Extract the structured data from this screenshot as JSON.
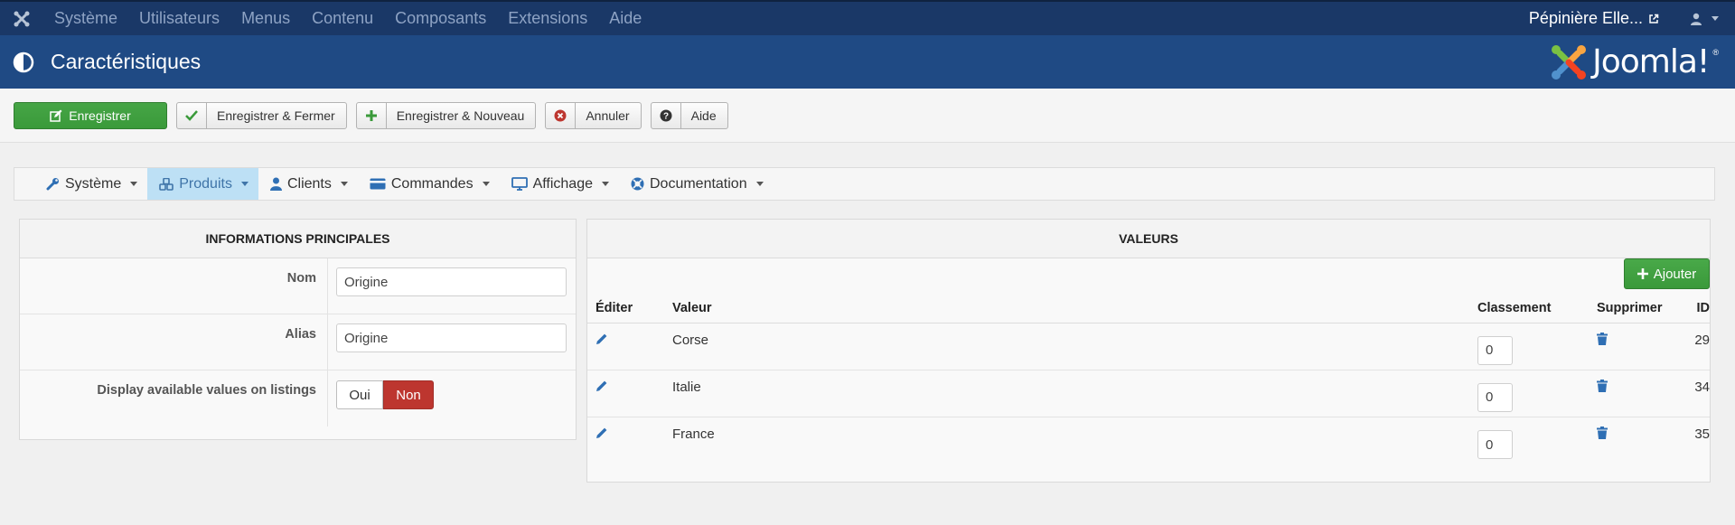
{
  "topbar": {
    "menu": [
      "Système",
      "Utilisateurs",
      "Menus",
      "Contenu",
      "Composants",
      "Extensions",
      "Aide"
    ],
    "site_name": "Pépinière Elle..."
  },
  "header": {
    "title": "Caractéristiques",
    "brand": "Joomla!",
    "brand_reg": "®"
  },
  "toolbar": {
    "save_label": "Enregistrer",
    "save_close_label": "Enregistrer & Fermer",
    "save_new_label": "Enregistrer & Nouveau",
    "cancel_label": "Annuler",
    "help_label": "Aide"
  },
  "compnav": {
    "items": [
      {
        "label": "Système",
        "icon": "wrench-icon",
        "active": false
      },
      {
        "label": "Produits",
        "icon": "cubes-icon",
        "active": true
      },
      {
        "label": "Clients",
        "icon": "user-icon",
        "active": false
      },
      {
        "label": "Commandes",
        "icon": "credit-card-icon",
        "active": false
      },
      {
        "label": "Affichage",
        "icon": "monitor-icon",
        "active": false
      },
      {
        "label": "Documentation",
        "icon": "lifebuoy-icon",
        "active": false
      }
    ]
  },
  "main_info": {
    "heading": "INFORMATIONS PRINCIPALES",
    "name_label": "Nom",
    "name_value": "Origine",
    "alias_label": "Alias",
    "alias_value": "Origine",
    "display_label": "Display available values on listings",
    "yes_label": "Oui",
    "no_label": "Non"
  },
  "values": {
    "heading": "VALEURS",
    "add_label": "Ajouter",
    "columns": {
      "edit": "Éditer",
      "value": "Valeur",
      "rank": "Classement",
      "delete": "Supprimer",
      "id": "ID"
    },
    "rows": [
      {
        "value": "Corse",
        "rank": "0",
        "id": "29"
      },
      {
        "value": "Italie",
        "rank": "0",
        "id": "34"
      },
      {
        "value": "France",
        "rank": "0",
        "id": "35"
      }
    ]
  },
  "colors": {
    "topbar": "#1a3867",
    "header": "#1f4a84",
    "primary_green": "#46a546",
    "danger_red": "#bd362f",
    "link_blue": "#2f6fb4",
    "active_nav": "#bde0f5"
  }
}
